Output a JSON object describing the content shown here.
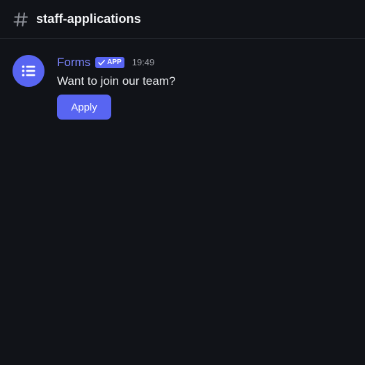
{
  "channel": {
    "icon": "hash-icon",
    "name": "staff-applications"
  },
  "message": {
    "avatar_icon": "list-icon",
    "author": "Forms",
    "app_tag": "APP",
    "app_tag_icon": "check-icon",
    "timestamp": "19:49",
    "text": "Want to join our team?",
    "button_label": "Apply"
  },
  "colors": {
    "background": "#111318",
    "accent": "#5865f2",
    "author": "#7c86ff",
    "text": "#e3e5e8",
    "muted": "#9a9ca3"
  }
}
